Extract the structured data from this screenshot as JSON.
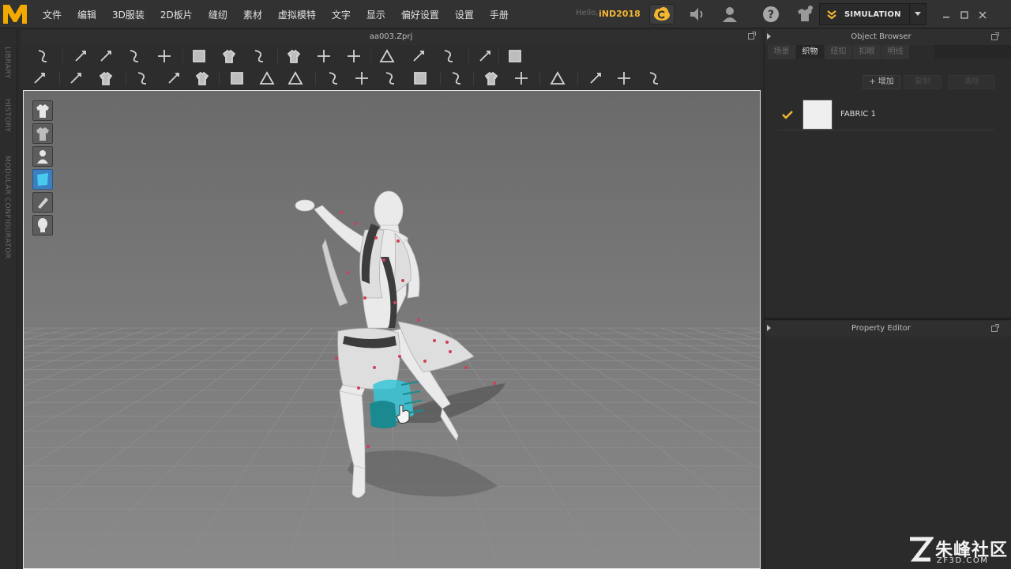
{
  "app": {
    "logo": "MD logo",
    "menu": [
      "文件",
      "编辑",
      "3D服装",
      "2D板片",
      "缝纫",
      "素材",
      "虚拟模特",
      "文字",
      "显示",
      "偏好设置",
      "设置",
      "手册"
    ],
    "greeting": "Hello,",
    "username": "iND2018",
    "mode_label": "SIMULATION",
    "accent": "#f2b632",
    "icons": [
      "cloud-sync-icon",
      "speaker-icon",
      "user-icon",
      "help-icon",
      "avatar-shirt-icon",
      "simulation-icon",
      "dropdown-arrow-icon",
      "minimize-icon",
      "maximize-icon",
      "close-icon"
    ]
  },
  "left_tabs": [
    "LIBRARY",
    "HISTORY",
    "MODULAR CONFIGURATOR"
  ],
  "viewport": {
    "file_title": "aa003.Zprj",
    "toolbar1_icons": [
      "fold-arrange-icon",
      "select-move-icon",
      "transform-pattern-icon",
      "edit-pattern-icon",
      "edit-point-icon",
      "rectangle-icon",
      "polygon-icon",
      "circle-icon",
      "internal-line-icon",
      "fold-icon",
      "tack-icon",
      "segment-sewing-icon",
      "free-sewing-icon",
      "check-sewing-icon",
      "arrangement-icon",
      "pin-icon"
    ],
    "toolbar2_icons": [
      "avatar-pose-icon",
      "brush-icon",
      "measure-icon",
      "texture-edit-icon",
      "transform-graphic-icon",
      "fold-3d-icon",
      "puckering-icon",
      "shirring-icon",
      "seamline-icon",
      "button-icon",
      "buttonhole-icon",
      "zipper-icon",
      "hem-icon",
      "lining-icon",
      "fusible-icon",
      "trim-icon",
      "avatar-measure-icon",
      "garment-fit-icon",
      "strain-map-icon",
      "pressure-map-icon"
    ],
    "side_tools": [
      "garment-view-icon",
      "garment-texture-icon",
      "avatar-view-icon",
      "active-fabric-icon",
      "surface-icon",
      "avatar-head-icon"
    ]
  },
  "object_browser": {
    "title": "Object Browser",
    "tabs": [
      "场景",
      "织物",
      "纽扣",
      "扣眼",
      "明线"
    ],
    "active_tab": "织物",
    "buttons": {
      "add": "+ 增加",
      "copy": "复制",
      "clear": "清除"
    },
    "fabrics": [
      {
        "name": "FABRIC 1",
        "checked": true,
        "color": "#efefef"
      }
    ]
  },
  "property_editor": {
    "title": "Property Editor"
  },
  "watermark": {
    "text": "朱峰社区",
    "sub": "ZF3D.COM"
  }
}
